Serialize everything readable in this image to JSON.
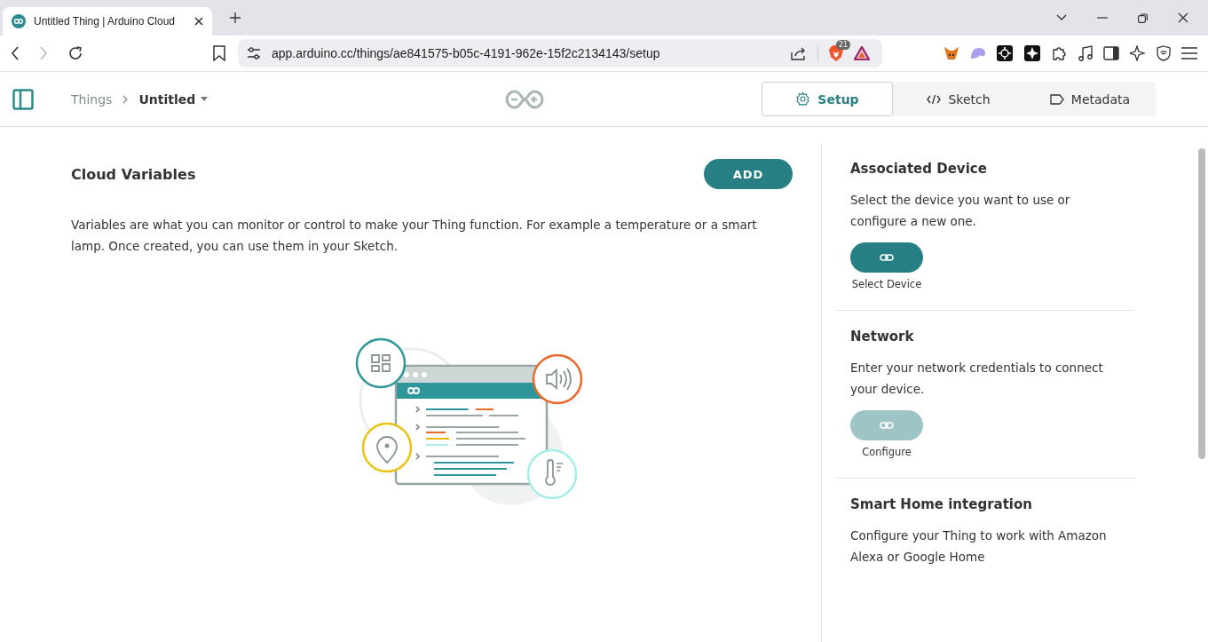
{
  "browser": {
    "tab_title": "Untitled Thing | Arduino Cloud",
    "address": "app.arduino.cc/things/ae841575-b05c-4191-962e-15f2c2134143/setup",
    "shield_count": "21"
  },
  "header": {
    "breadcrumb": [
      "Things",
      "Untitled"
    ],
    "tabs": [
      {
        "label": "Setup",
        "kind": "setup",
        "selected": true
      },
      {
        "label": "Sketch",
        "kind": "sketch",
        "selected": false
      },
      {
        "label": "Metadata",
        "kind": "metadata",
        "selected": false
      }
    ]
  },
  "main": {
    "title": "Cloud Variables",
    "add_button": "ADD",
    "description": "Variables are what you can monitor or control to make your Thing function. For example a temperature or a smart lamp. Once created, you can use them in your Sketch."
  },
  "sidebar": [
    {
      "title": "Associated Device",
      "text": "Select the device you want to use or configure a new one.",
      "button": {
        "label": "Select Device",
        "disabled": false
      }
    },
    {
      "title": "Network",
      "text": "Enter your network credentials to connect your device.",
      "button": {
        "label": "Configure",
        "disabled": true
      }
    },
    {
      "title": "Smart Home integration",
      "text": "Configure your Thing to work with Amazon Alexa or Google Home"
    }
  ]
}
